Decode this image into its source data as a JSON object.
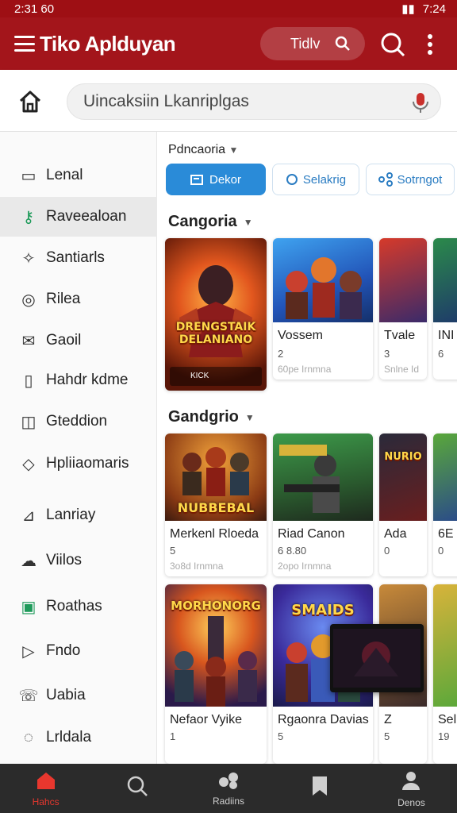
{
  "status_bar": {
    "time_left": "2:31 60",
    "time_right": "7:24"
  },
  "app_bar": {
    "title": "Tiko Aplduyan",
    "search_value": "Tidlv"
  },
  "search": {
    "placeholder": "Uincaksiin Lkanriplgas"
  },
  "sidebar": {
    "items": [
      {
        "label": "Lenal",
        "icon": "tag-icon"
      },
      {
        "label": "Raveealoan",
        "icon": "key-icon",
        "active": true
      },
      {
        "label": "Santiarls",
        "icon": "puzzle-icon"
      },
      {
        "label": "Rilea",
        "icon": "swirl-icon"
      },
      {
        "label": "Gaoil",
        "icon": "mail-icon"
      },
      {
        "label": "Hahdr kdme",
        "icon": "book-icon"
      },
      {
        "label": "Gteddion",
        "icon": "ticket-icon"
      },
      {
        "label": "Hpliiaomaris",
        "icon": "price-tag-icon"
      },
      {
        "label": "Lanriay",
        "icon": "chart-icon"
      },
      {
        "label": "Viilos",
        "icon": "cloud-icon"
      },
      {
        "label": "Roathas",
        "icon": "app-icon"
      },
      {
        "label": "Fndo",
        "icon": "play-icon"
      },
      {
        "label": "Uabia",
        "icon": "phone-icon"
      },
      {
        "label": "Lrldala",
        "icon": "chat-icon"
      }
    ]
  },
  "filters": {
    "label": "Pdncaoria",
    "chips": [
      {
        "label": "Dekor",
        "icon": "edit-icon"
      },
      {
        "label": "Selakrig",
        "icon": "circle-icon"
      },
      {
        "label": "Sotrngot",
        "icon": "share-icon"
      }
    ]
  },
  "sections": [
    {
      "title": "Cangoria",
      "cards": [
        {
          "art_text": "DRENGSTAIK DELANIANO",
          "badge": "KICK",
          "title": "",
          "meta": "",
          "sub": ""
        },
        {
          "title": "Vossem",
          "meta": "2",
          "sub": "60pe Irnmna"
        },
        {
          "title": "Tvale",
          "meta": "3",
          "sub": "Snlne Id"
        },
        {
          "title": "INI",
          "meta": "6",
          "sub": ""
        }
      ]
    },
    {
      "title": "Gandgrio",
      "cards": [
        {
          "art_text": "NUBBEBAL",
          "title": "Merkenl Rloeda",
          "meta": "5",
          "sub": "3o8d Irnmna"
        },
        {
          "art_text": "",
          "title": "Riad Canon",
          "meta": "6  8.80",
          "sub": "2opo Irnmna"
        },
        {
          "art_text": "NURIO",
          "title": "Ada",
          "meta": "0",
          "sub": ""
        },
        {
          "title": "6E",
          "meta": "0",
          "sub": ""
        }
      ]
    },
    {
      "cards": [
        {
          "art_text": "MORHONORG",
          "title": "Nefaor Vyike",
          "meta": "1",
          "sub": ""
        },
        {
          "art_text": "SMAIDS",
          "title": "Rgaonra Davias",
          "meta": "5",
          "sub": ""
        },
        {
          "art_text": "",
          "title": "Z",
          "meta": "5",
          "sub": ""
        },
        {
          "title": "Sel",
          "meta": "19",
          "sub": ""
        }
      ]
    }
  ],
  "bottom_nav": [
    {
      "label": "Hahcs",
      "icon": "home-icon",
      "active": true
    },
    {
      "label": "",
      "icon": "search-icon"
    },
    {
      "label": "Radiins",
      "icon": "gamepad-icon"
    },
    {
      "label": "",
      "icon": "bookmark-icon"
    },
    {
      "label": "Denos",
      "icon": "profile-icon"
    }
  ],
  "colors": {
    "brand": "#a3151b",
    "accent": "#2a8bd8",
    "nav_active": "#e8372e"
  }
}
